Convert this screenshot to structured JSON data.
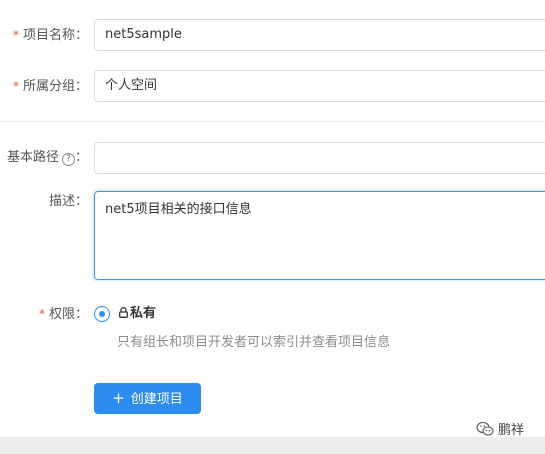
{
  "form": {
    "project_name": {
      "label": "项目名称：",
      "required_mark": "*",
      "value": "net5sample"
    },
    "group": {
      "label": "所属分组：",
      "required_mark": "*",
      "value": "个人空间"
    },
    "base_path": {
      "label": "基本路径",
      "help": "?",
      "colon": "：",
      "value": ""
    },
    "description": {
      "label": "描述：",
      "value": "net5项目相关的接口信息"
    },
    "permission": {
      "label": "权限：",
      "required_mark": "*",
      "option_label": "私有",
      "option_selected": true,
      "description": "只有组长和项目开发者可以索引并查看项目信息"
    },
    "create_button": {
      "icon": "+",
      "label": "创建项目"
    }
  },
  "watermark": {
    "text": "鹏祥"
  },
  "colors": {
    "primary": "#2d8cf0",
    "required": "#e4572e",
    "border": "#d9d9d9",
    "muted": "#8c8c8c"
  }
}
